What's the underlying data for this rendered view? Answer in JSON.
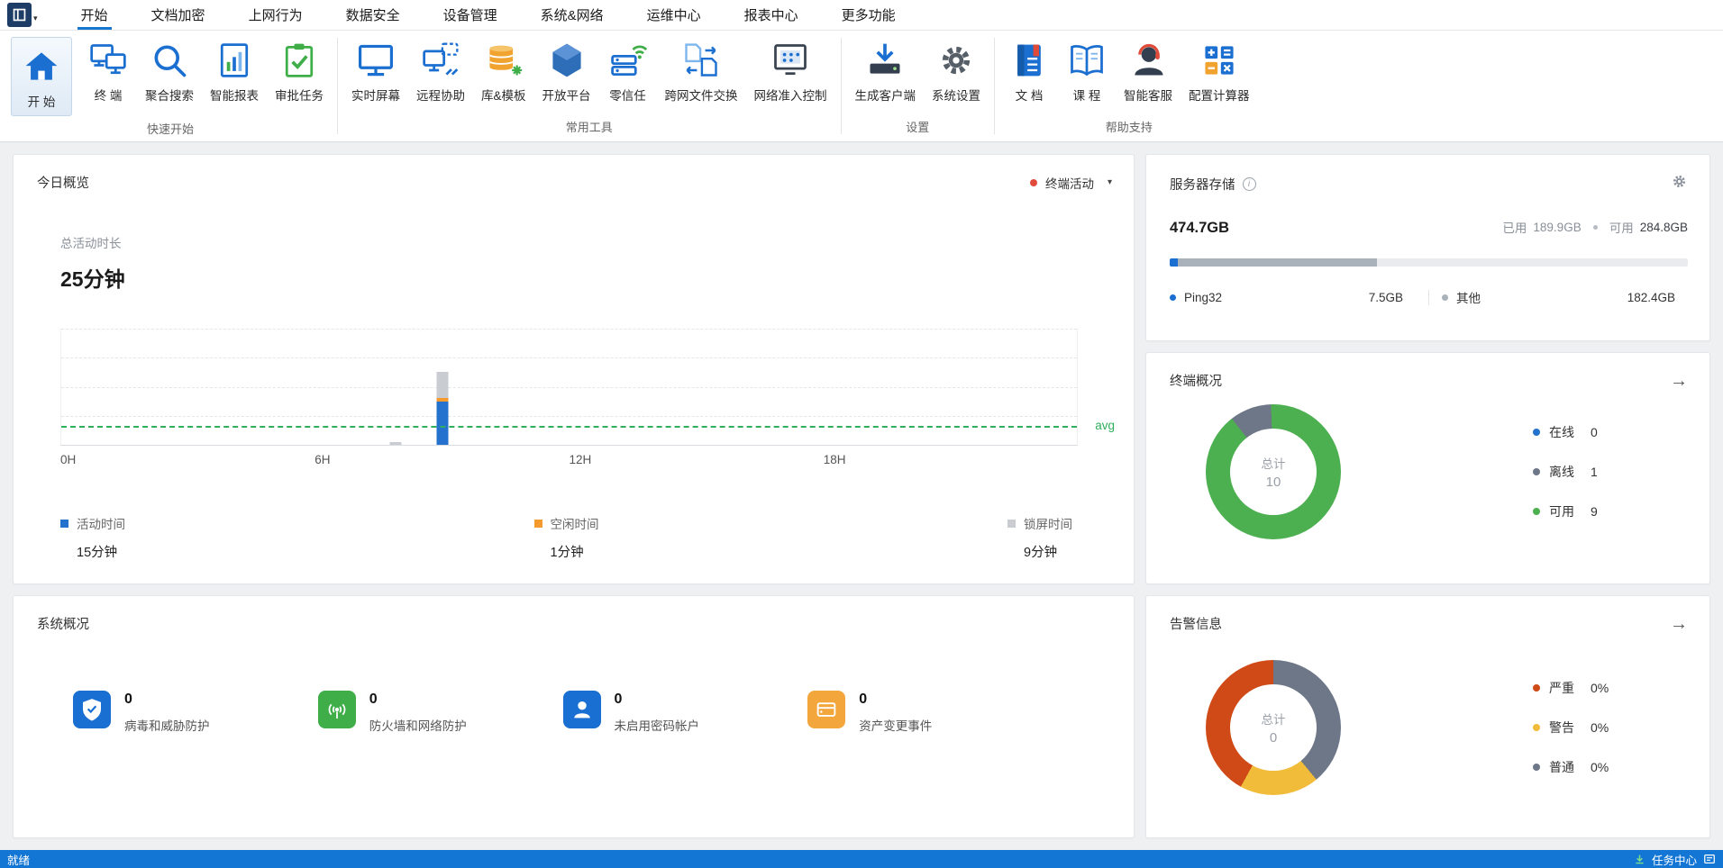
{
  "icons": {
    "caret": "▾",
    "arrow": "→",
    "info": "i"
  },
  "menu": {
    "tabs": [
      {
        "label": "开始",
        "active": true
      },
      {
        "label": "文档加密"
      },
      {
        "label": "上网行为"
      },
      {
        "label": "数据安全"
      },
      {
        "label": "设备管理"
      },
      {
        "label": "系统&网络"
      },
      {
        "label": "运维中心"
      },
      {
        "label": "报表中心"
      },
      {
        "label": "更多功能"
      }
    ]
  },
  "ribbon": {
    "groups": [
      {
        "label": "快速开始",
        "items": [
          {
            "label": "开 始"
          },
          {
            "label": "终 端"
          },
          {
            "label": "聚合搜索"
          },
          {
            "label": "智能报表"
          },
          {
            "label": "审批任务"
          }
        ]
      },
      {
        "label": "常用工具",
        "items": [
          {
            "label": "实时屏幕"
          },
          {
            "label": "远程协助"
          },
          {
            "label": "库&模板"
          },
          {
            "label": "开放平台"
          },
          {
            "label": "零信任"
          },
          {
            "label": "跨网文件交换"
          },
          {
            "label": "网络准入控制"
          }
        ]
      },
      {
        "label": "设置",
        "items": [
          {
            "label": "生成客户端"
          },
          {
            "label": "系统设置"
          }
        ]
      },
      {
        "label": "帮助支持",
        "items": [
          {
            "label": "文 档"
          },
          {
            "label": "课 程"
          },
          {
            "label": "智能客服"
          },
          {
            "label": "配置计算器"
          }
        ]
      }
    ]
  },
  "overview": {
    "title": "今日概览",
    "filter_label": "终端活动",
    "filter_dot_color": "#e04b3a",
    "total_label": "总活动时长",
    "total_value": "25分钟",
    "legend": [
      {
        "label": "活动时间",
        "value": "15分钟",
        "color": "#2472cd"
      },
      {
        "label": "空闲时间",
        "value": "1分钟",
        "color": "#f59b2d"
      },
      {
        "label": "锁屏时间",
        "value": "9分钟",
        "color": "#c9cdd2"
      }
    ]
  },
  "storage": {
    "title": "服务器存储",
    "total": "474.7GB",
    "used_label": "已用",
    "used_value": "189.9GB",
    "free_label": "可用",
    "free_value": "284.8GB",
    "bar_segments": [
      {
        "label": "Ping32",
        "pct": 1.6,
        "color": "#1b6fd0"
      },
      {
        "label": "已用其他",
        "pct": 38.4,
        "color": "#a9b1ba"
      }
    ],
    "legend": [
      {
        "label": "Ping32",
        "value": "7.5GB",
        "color": "#1b6fd0"
      },
      {
        "label": "其他",
        "value": "182.4GB",
        "color": "#a9b1ba"
      }
    ]
  },
  "terminal": {
    "title": "终端概况",
    "center_label": "总计",
    "center_value": "10",
    "legend": [
      {
        "label": "在线",
        "value": "0",
        "color": "#2472cd"
      },
      {
        "label": "离线",
        "value": "1",
        "color": "#6e7787"
      },
      {
        "label": "可用",
        "value": "9",
        "color": "#4caf50"
      }
    ]
  },
  "alerts": {
    "title": "告警信息",
    "center_label": "总计",
    "center_value": "0",
    "legend": [
      {
        "label": "严重",
        "value": "0%",
        "color": "#cf4a17"
      },
      {
        "label": "警告",
        "value": "0%",
        "color": "#f2bc3b"
      },
      {
        "label": "普通",
        "value": "0%",
        "color": "#6e7787"
      }
    ]
  },
  "system": {
    "title": "系统概况",
    "items": [
      {
        "value": "0",
        "label": "病毒和威胁防护",
        "icon": "shield-icon",
        "color": "#1a6fd2"
      },
      {
        "value": "0",
        "label": "防火墙和网络防护",
        "icon": "firewall-icon",
        "color": "#3fae49"
      },
      {
        "value": "0",
        "label": "未启用密码帐户",
        "icon": "user-icon",
        "color": "#1a6fd2"
      },
      {
        "value": "0",
        "label": "资产变更事件",
        "icon": "asset-icon",
        "color": "#f2a63b"
      }
    ]
  },
  "status": {
    "left": "就绪",
    "task_center": "任务中心"
  },
  "chart_data": [
    {
      "type": "bar",
      "title": "今日概览 - 终端活动",
      "x_ticks": [
        "0H",
        "6H",
        "12H",
        "18H"
      ],
      "x_range_hours": [
        0,
        24
      ],
      "ylim": [
        0,
        40
      ],
      "avg_value": 6,
      "avg_label": "avg",
      "grid": "dashed-horizontal",
      "series": [
        {
          "name": "活动时间",
          "color": "#2472cd",
          "total": "15分钟"
        },
        {
          "name": "空闲时间",
          "color": "#f59b2d",
          "total": "1分钟"
        },
        {
          "name": "锁屏时间",
          "color": "#c9cdd2",
          "total": "9分钟"
        }
      ],
      "bars": [
        {
          "hour": 7.9,
          "values": [
            0,
            0,
            1
          ]
        },
        {
          "hour": 9,
          "values": [
            15,
            1,
            9
          ]
        }
      ]
    },
    {
      "type": "donut",
      "title": "终端概况",
      "center_label": "总计",
      "center_value": "10",
      "start_deg": -38,
      "segments": [
        {
          "name": "离线",
          "value": 1,
          "pct": 10,
          "color": "#6e7787"
        },
        {
          "name": "可用",
          "value": 9,
          "pct": 90,
          "color": "#4caf50"
        }
      ]
    },
    {
      "type": "donut",
      "title": "告警信息",
      "center_label": "总计",
      "center_value": "0",
      "start_deg": 0,
      "segments": [
        {
          "name": "普通",
          "pct": 39,
          "color": "#6e7787"
        },
        {
          "name": "警告",
          "pct": 19,
          "color": "#f2bc3b"
        },
        {
          "name": "严重",
          "pct": 42,
          "color": "#cf4a17"
        }
      ]
    }
  ]
}
